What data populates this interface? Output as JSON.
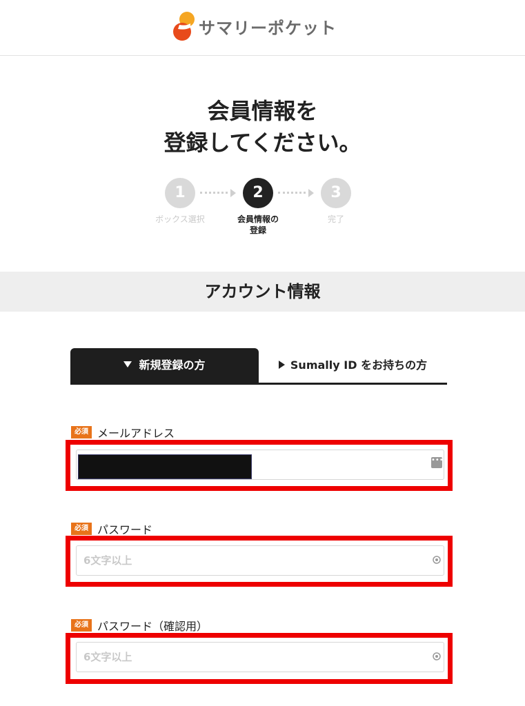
{
  "header": {
    "logo_text": "サマリーポケット",
    "brand_colors": {
      "top": "#f5a623",
      "bottom": "#e84a1b"
    }
  },
  "title": {
    "line1": "会員情報を",
    "line2": "登録してください。"
  },
  "steps": [
    {
      "number": "1",
      "label": "ボックス選択",
      "state": "done"
    },
    {
      "number": "2",
      "label_line1": "会員情報の",
      "label_line2": "登録",
      "state": "current"
    },
    {
      "number": "3",
      "label": "完了",
      "state": "todo"
    }
  ],
  "section": {
    "title": "アカウント情報"
  },
  "tabs": {
    "active": "新規登録の方",
    "inactive": "Sumally ID をお持ちの方"
  },
  "form": {
    "required_badge": "必須",
    "email": {
      "label": "メールアドレス",
      "value_redacted": true
    },
    "password": {
      "label": "パスワード",
      "placeholder": "6文字以上"
    },
    "password_confirm": {
      "label": "パスワード（確認用）",
      "placeholder": "6文字以上"
    }
  },
  "colors": {
    "highlight": "#ee0000",
    "badge": "#e8731a",
    "active_tab": "#1e1e1e"
  }
}
